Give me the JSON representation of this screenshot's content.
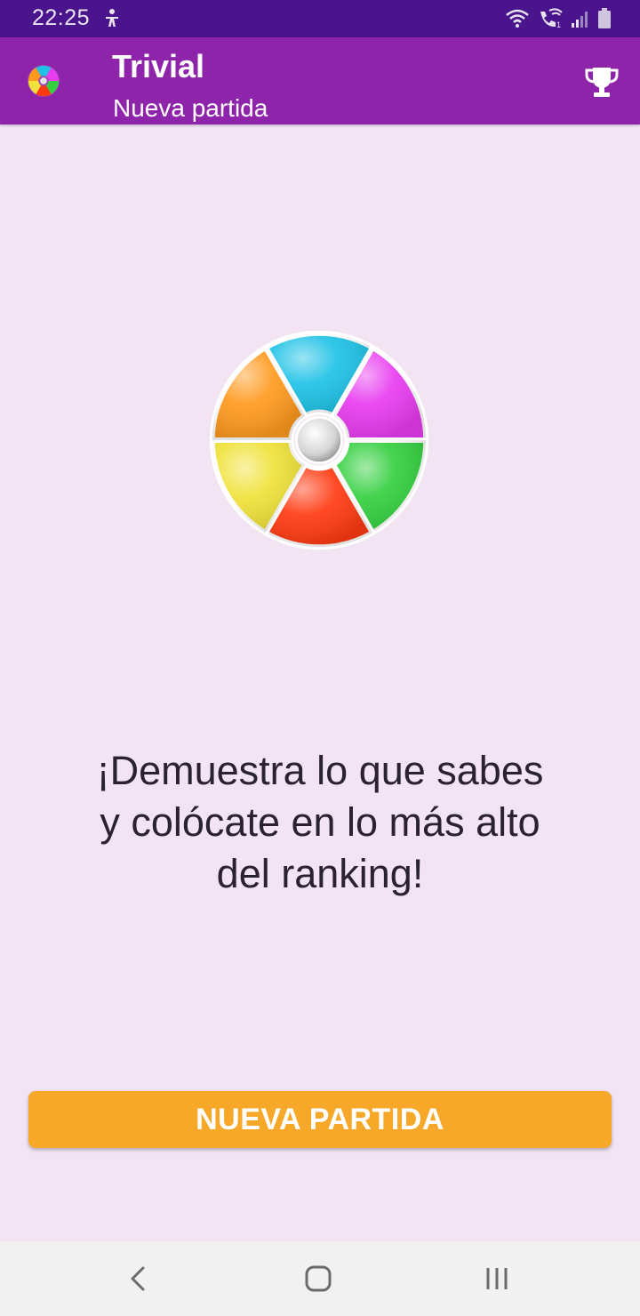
{
  "status_bar": {
    "time": "22:25",
    "icons": [
      "accessibility-icon",
      "wifi-icon",
      "wifi-calling-icon",
      "signal-icon",
      "battery-icon"
    ]
  },
  "app_bar": {
    "title": "Trivial",
    "subtitle": "Nueva partida",
    "logo_icon": "trivial-wheel-icon",
    "action_icon": "trophy-icon"
  },
  "main": {
    "logo_icon": "trivial-wheel-icon",
    "tagline_lines": [
      "¡Demuestra lo que sabes",
      "y colócate en lo más alto",
      "del ranking!"
    ],
    "new_game_button": "NUEVA PARTIDA"
  },
  "nav_bar": {
    "icons": [
      "back-icon",
      "home-icon",
      "recent-apps-icon"
    ]
  },
  "colors": {
    "status_bar": "#4a148c",
    "app_bar": "#8e24aa",
    "background": "#f3e4f4",
    "button": "#f7a828",
    "wedge_orange": "#ff9a1f",
    "wedge_cyan": "#1fc2e6",
    "wedge_magenta": "#e83cf0",
    "wedge_green": "#35d040",
    "wedge_red": "#ff3a12",
    "wedge_yellow": "#f0e23a"
  }
}
